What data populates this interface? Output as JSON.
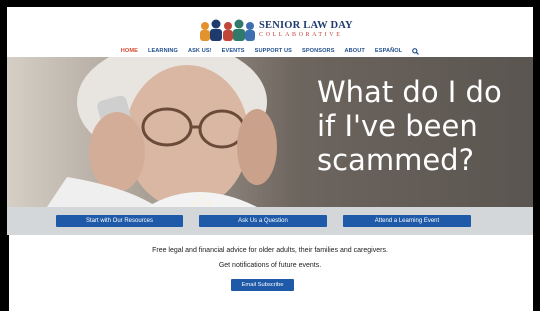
{
  "header": {
    "logo_title": "SENIOR LAW DAY",
    "logo_subtitle": "COLLABORATIVE"
  },
  "nav": {
    "items": [
      {
        "label": "HOME",
        "active": true
      },
      {
        "label": "LEARNING",
        "active": false
      },
      {
        "label": "ASK US!",
        "active": false
      },
      {
        "label": "EVENTS",
        "active": false
      },
      {
        "label": "SUPPORT US",
        "active": false
      },
      {
        "label": "SPONSORS",
        "active": false
      },
      {
        "label": "ABOUT",
        "active": false
      },
      {
        "label": "ESPAÑOL",
        "active": false
      }
    ],
    "search_icon": "search-icon",
    "link_color": "#1f4e8c",
    "active_color": "#d44a2e"
  },
  "hero": {
    "heading": "What do I do if I've been scammed?"
  },
  "actions": {
    "resources": "Start with Our Resources",
    "ask": "Ask Us a Question",
    "attend": "Attend a Learning Event"
  },
  "main": {
    "tagline": "Free legal and financial advice for older adults, their families and caregivers.",
    "notify": "Get notifications of future events.",
    "subscribe": "Email Subscribe"
  },
  "colors": {
    "button": "#1f5aa8",
    "button_bar": "#d4d7da"
  }
}
